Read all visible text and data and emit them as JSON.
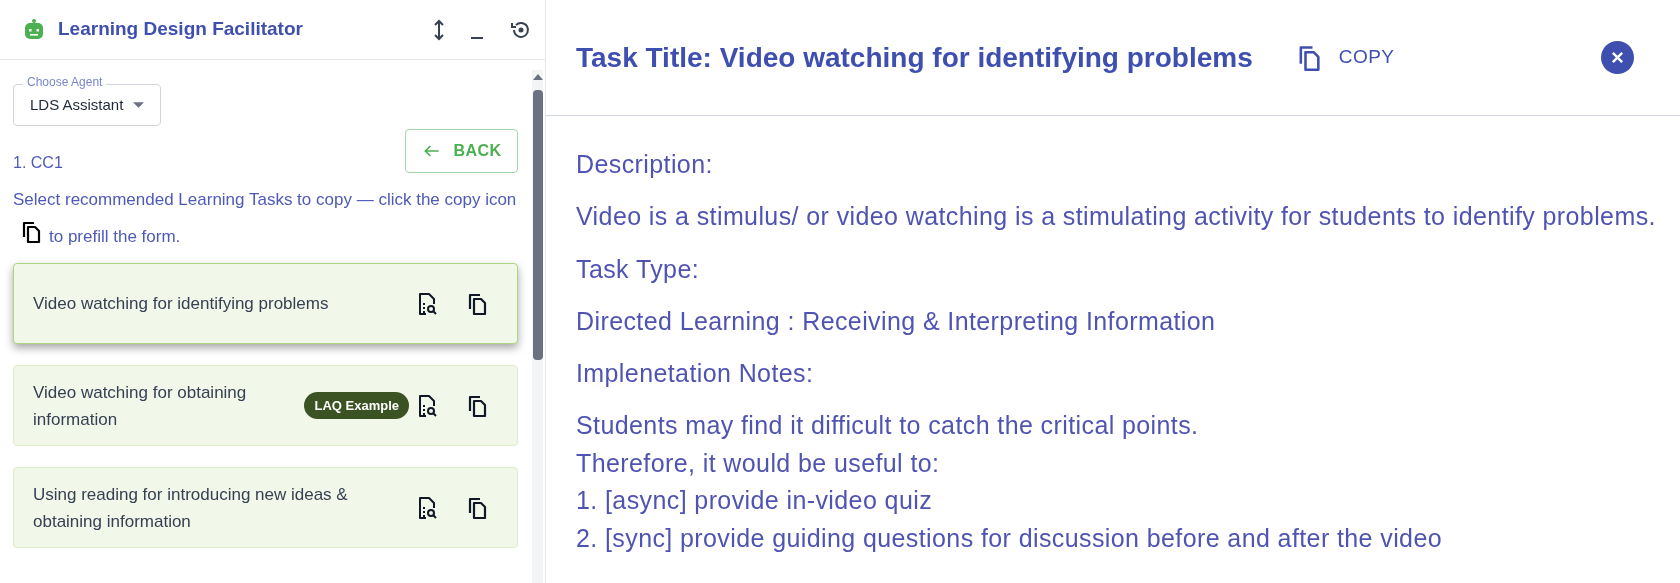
{
  "panel": {
    "title": "Learning Design Facilitator"
  },
  "agent_select": {
    "label": "Choose Agent",
    "value": "LDS Assistant"
  },
  "section": "1. CC1",
  "back_button": "BACK",
  "instruction": {
    "before": "Select recommended Learning Tasks to copy — click the copy icon",
    "after": "to prefill the form."
  },
  "tasks": [
    {
      "title": "Video watching for identifying problems",
      "selected": true
    },
    {
      "title": "Video watching for obtaining information",
      "badge": "LAQ Example",
      "selected": false
    },
    {
      "title": "Using reading for introducing new ideas & obtaining information",
      "selected": false
    }
  ],
  "detail": {
    "title": "Task Title: Video watching for identifying problems",
    "copy_button": "COPY",
    "fields": [
      {
        "label": "Description:",
        "lines": [
          "Video is a stimulus/ or video watching is a stimulating activity for students to identify problems."
        ]
      },
      {
        "label": "Task Type:",
        "lines": [
          "Directed Learning : Receiving & Interpreting Information"
        ]
      },
      {
        "label": "Implenetation Notes:",
        "lines": [
          "Students may find it difficult to catch the critical points.",
          "Therefore, it would be useful to:",
          "1. [async] provide in-video quiz",
          "2. [sync] provide guiding questions for discussion before and after the video"
        ]
      }
    ]
  }
}
